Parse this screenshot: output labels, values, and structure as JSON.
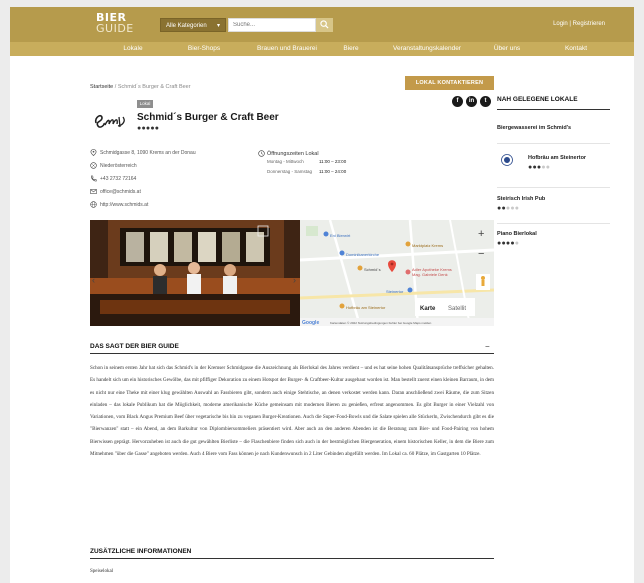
{
  "header": {
    "logo_line1": "BIER",
    "logo_line2": "GUIDE",
    "category_select": "Alle Kategorien",
    "search_placeholder": "Suche...",
    "login": "Login | Registrieren"
  },
  "nav": [
    "Lokale",
    "Bier-Shops",
    "Brauen und Brauerei",
    "Biere",
    "Veranstaltungskalender",
    "Über uns",
    "Kontakt"
  ],
  "breadcrumb": {
    "home": "Startseite",
    "separator": "/",
    "current": "Schmid´s Burger & Craft Beer"
  },
  "contact_button": "LOKAL KONTAKTIEREN",
  "social": [
    "f",
    "in",
    "t"
  ],
  "place": {
    "tag": "Lokal",
    "title": "Schmid´s Burger & Craft Beer",
    "rating": 5,
    "address": "Schmidgasse 8, 1090 Krems an der Donau",
    "region": "Niederösterreich",
    "phone": "+43 2732 72164",
    "email": "office@schmids.at",
    "website": "http://www.schmids.at"
  },
  "hours": {
    "title": "Öffnungszeiten Lokal",
    "rows": [
      {
        "days": "Montag - Mittwoch",
        "time": "11:00 – 23:00"
      },
      {
        "days": "Donnerstag - Samstag",
        "time": "11:00 – 24:00"
      }
    ]
  },
  "map": {
    "labels": [
      "Eni Bierwirt",
      "Dominikanerkirche",
      "Marktplatz Krems",
      "Schmid´s",
      "Adler Apotheke Krems",
      "Mag. Gabriele Denk",
      "Steinertor",
      "Hofbräu am Steinertor"
    ],
    "toggle_map": "Karte",
    "toggle_sat": "Satellit",
    "zoom_in": "+",
    "zoom_out": "−",
    "attribution_logo": "Google",
    "attribution": "Kartendaten © 2022   Nutzungsbedingungen   Fehler bei Google Maps melden"
  },
  "sections": {
    "about_title": "DAS SAGT DER BIER GUIDE",
    "extra_title": "ZUSÄTZLICHE INFORMATIONEN",
    "extra_text": "Speiselokal"
  },
  "description": "Schon in seinem ersten Jahr hat sich das Schmid's in der Kremser Schmidgasse die Auszeichnung als Bierlokal des Jahres verdient – und es hat seine hohen Qualitätsansprüche treffsicher gehalten. Es handelt sich um ein historisches Gewölbe, das mit pfiffiger Dekoration zu einem Hotspot der Burger- & Craftbeer-Kultur ausgebaut worden ist. Man bestellt zuerst einen kleinen Barraum, in dem es nicht nur eine Theke mit einer klug gewählten Auswahl an Fassbieren gibt, sondern auch einige Stehtische, an denen verkostet werden kann. Daran anschließend zwei Räume, die zum Sitzen einladen – das lokale Publikum hat die Möglichkeit, moderne amerikanische Küche gemeinsam mit modernen Bieren zu genießen, erfreut angenommen. Es gibt Burger in einer Vielzahl von Variationen, vom Black Angus Premium Beef über vegetarische bis hin zu veganen Burger-Kreationen. Auch die Super-Food-Bowls und die Salate spielen alle Stückerln, Zwischendurch gibt es die \"Bierwanzen\" statt – ein Abend, an dem Barkultur von Diplombiersommeliers präsentiert wird. Aber auch an den anderen Abenden ist die Beratung zum Bier- und Food-Pairing von hohem Bierwissen geprägt. Hervorzuheben ist auch die gut gewählten Bierliste – die Flaschenbiere finden sich auch in der bestmöglichen Biergeneration, einem historischen Keller, in dem die Biere zum Mitnehmen \"über die Gasse\" angeboten werden. Auch 4 Biere vom Fass können je nach Kundenwunsch in 2 Liter Gebinden abgefüllt werden. Im Lokal ca. 60 Plätze, im Gastgarten 10 Plätze.",
  "sidebar": {
    "title": "NAH GELEGENE LOKALE",
    "items": [
      {
        "name": "Biergewasserei im Schmid's",
        "rating": null
      },
      {
        "name": "Hofbräu am Steinertor",
        "rating": 3
      },
      {
        "name": "Steirisch Irish Pub",
        "rating": 2
      },
      {
        "name": "Piano Bierlokal",
        "rating": 4
      }
    ]
  },
  "colors": {
    "header": "#b69b4c",
    "nav": "#c8ad5c",
    "accent_button": "#c39a4a"
  }
}
